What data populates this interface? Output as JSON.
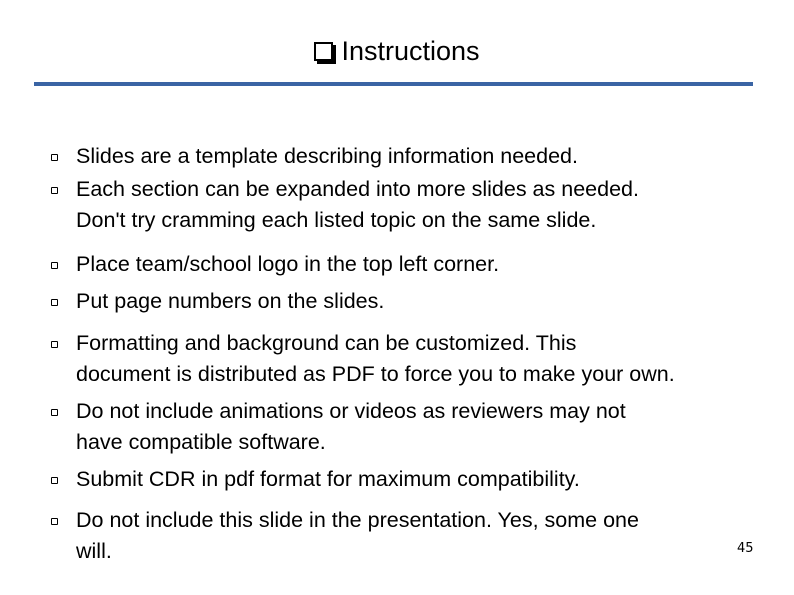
{
  "slide": {
    "title": "Instructions",
    "title_icon": "shadowed-square-bullet",
    "accent_color": "#3a64a4",
    "page_number": "45",
    "bullet_icon": "hollow-square-bullet",
    "items": [
      {
        "lines": [
          "Slides are a template describing information needed."
        ]
      },
      {
        "lines": [
          "Each section can be expanded into more slides as needed.",
          "Don't try cramming each listed topic on the same slide."
        ]
      },
      {
        "lines": [
          "Place team/school logo in the top left corner."
        ]
      },
      {
        "lines": [
          "Put page numbers on the slides."
        ]
      },
      {
        "lines": [
          "Formatting and background can be customized. This",
          "document is distributed as PDF to force you to make your own."
        ]
      },
      {
        "lines": [
          "Do not include animations or videos as reviewers may not",
          "have compatible software."
        ]
      },
      {
        "lines": [
          "Submit CDR in pdf format for maximum compatibility."
        ]
      },
      {
        "lines": [
          "Do not include this slide in the presentation. Yes, some one",
          "will."
        ]
      }
    ]
  }
}
